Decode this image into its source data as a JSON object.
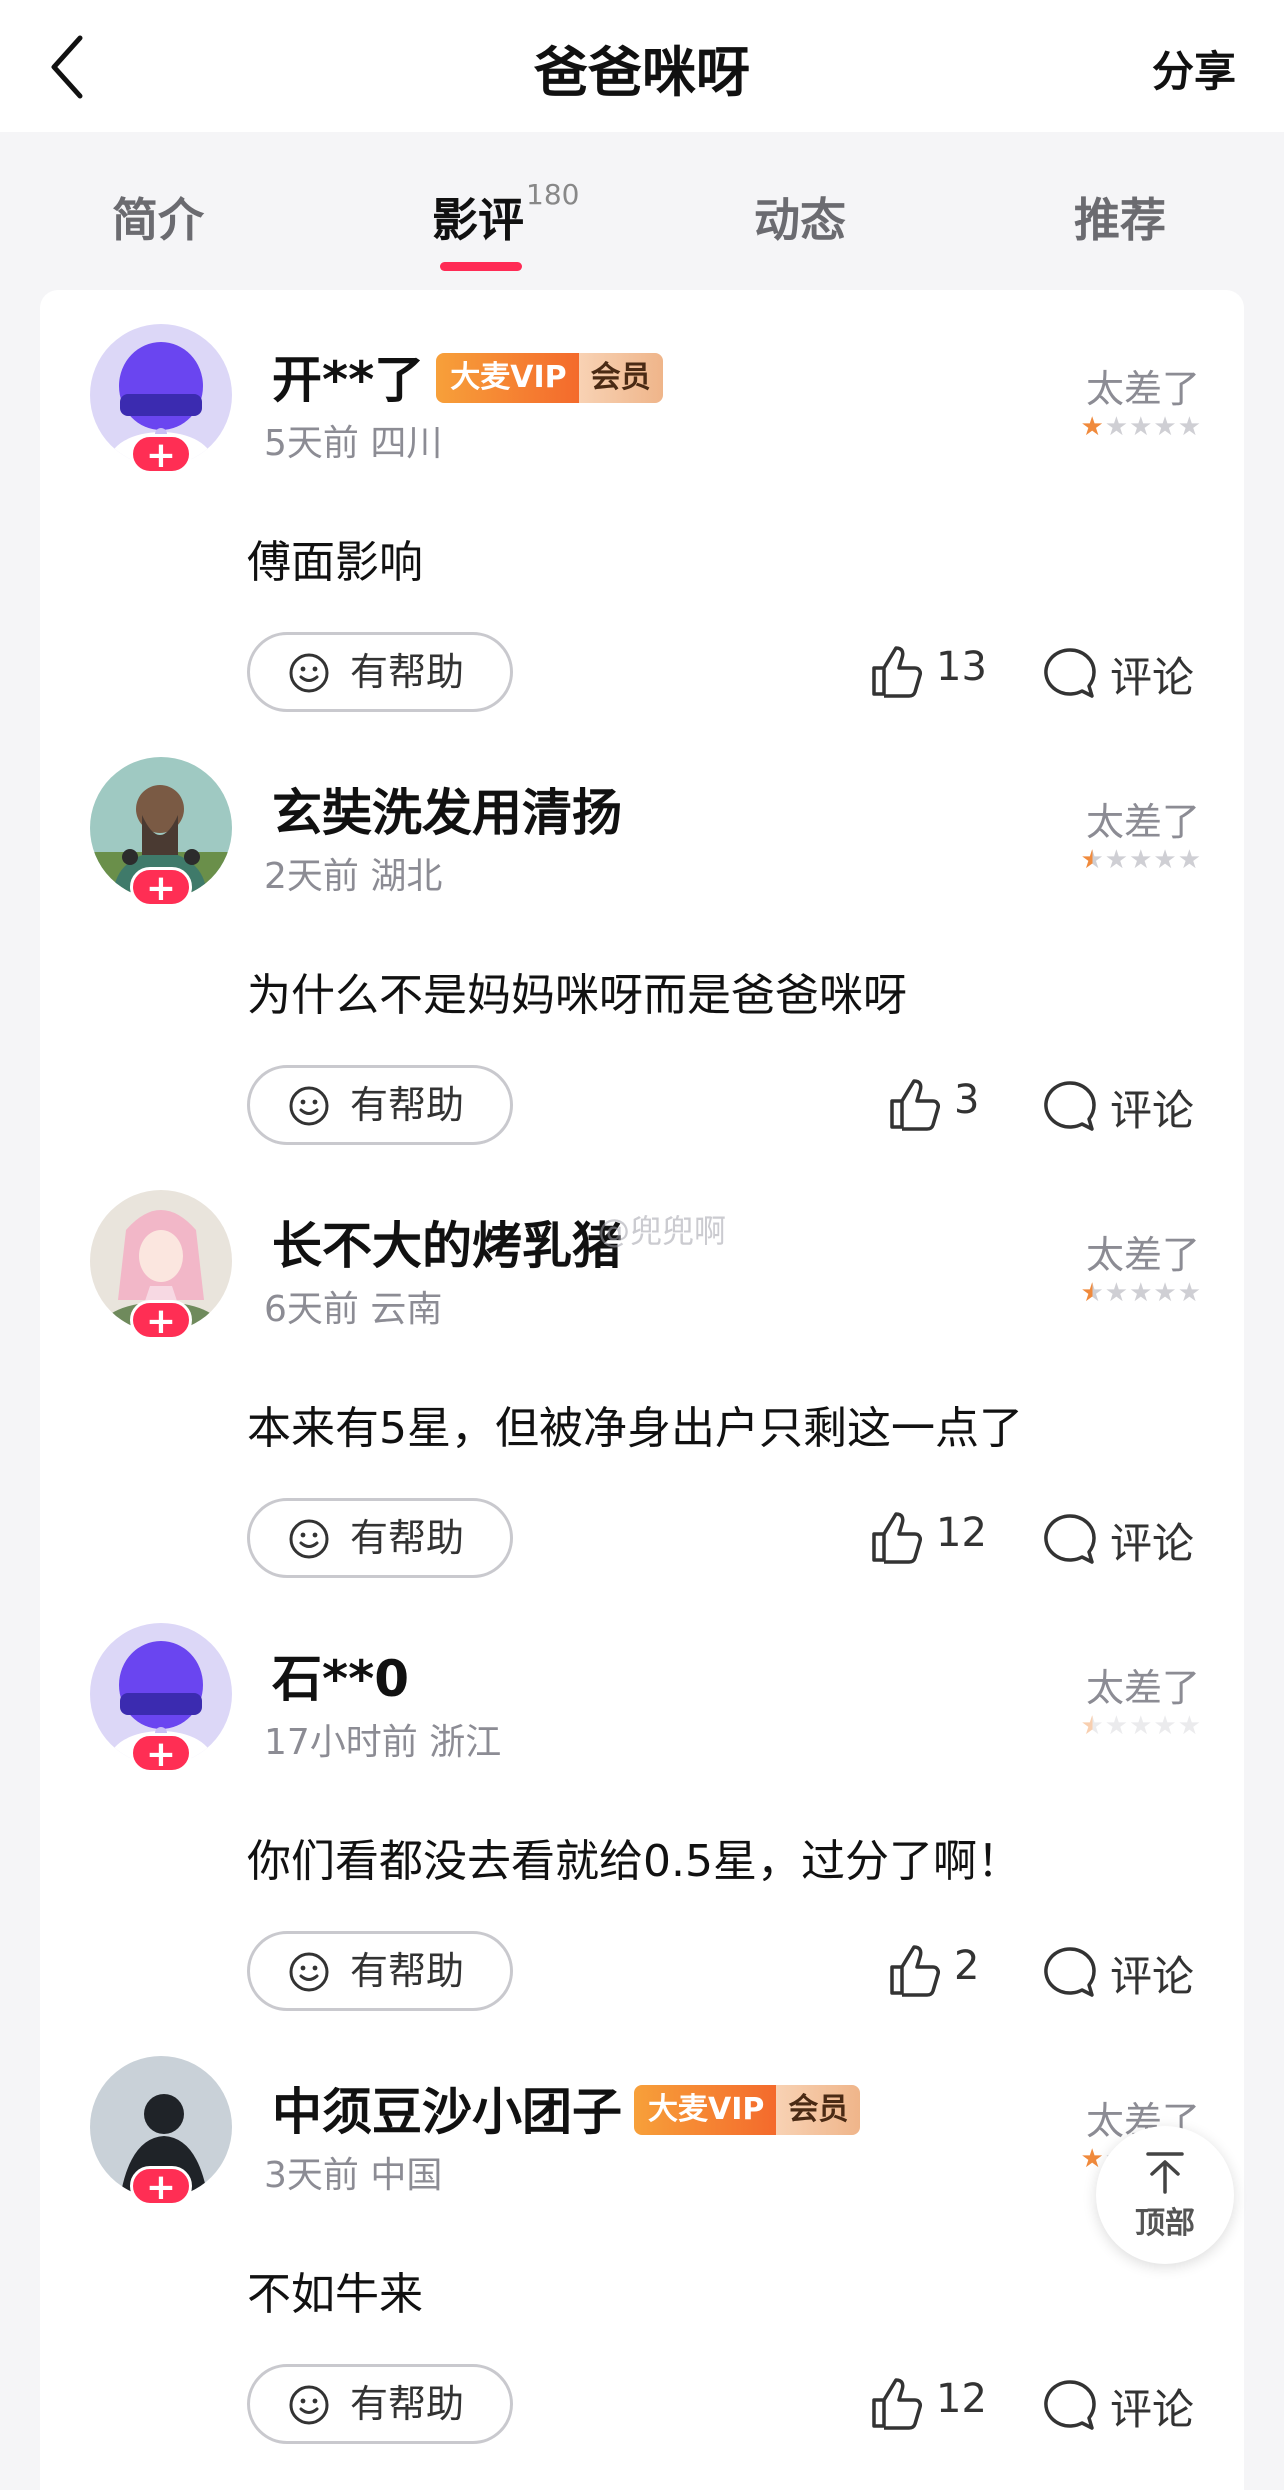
{
  "header": {
    "title": "爸爸咪呀",
    "share_label": "分享"
  },
  "tabs": [
    {
      "label": "简介"
    },
    {
      "label": "影评",
      "count": "180",
      "active": true
    },
    {
      "label": "动态"
    },
    {
      "label": "推荐"
    }
  ],
  "vip": {
    "a": "大麦VIP",
    "b": "会员"
  },
  "watermark": "@兜兜啊",
  "back_to_top": "顶部",
  "reviews": [
    {
      "user": "开**了",
      "vip": true,
      "meta": "5天前 四川",
      "rating_label": "太差了",
      "rating": 1,
      "content": "傅面影响",
      "helpful": "有帮助",
      "likes": "13",
      "comment": "评论",
      "avatar": "vr-icon"
    },
    {
      "user": "玄奘洗发用清扬",
      "vip": false,
      "meta": "2天前 湖北",
      "rating_label": "太差了",
      "rating": 0.5,
      "content": "为什么不是妈妈咪呀而是爸爸咪呀",
      "helpful": "有帮助",
      "likes": "3",
      "comment": "评论",
      "avatar": "monk-icon"
    },
    {
      "user": "长不大的烤乳猪",
      "vip": false,
      "meta": "6天前 云南",
      "rating_label": "太差了",
      "rating": 0.5,
      "content": "本来有5星，但被净身出户只剩这一点了",
      "helpful": "有帮助",
      "likes": "12",
      "comment": "评论",
      "avatar": "anime-girl-icon"
    },
    {
      "user": "石**0",
      "vip": false,
      "meta": "17小时前 浙江",
      "rating_label": "太差了",
      "rating": 0.5,
      "content": "你们看都没去看就给0.5星，过分了啊！",
      "helpful": "有帮助",
      "likes": "2",
      "comment": "评论",
      "avatar": "vr-icon"
    },
    {
      "user": "中须豆沙小团子",
      "vip": true,
      "meta": "3天前 中国",
      "rating_label": "太差了",
      "rating": 1,
      "content": "不如牛来",
      "helpful": "有帮助",
      "likes": "12",
      "comment": "评论",
      "avatar": "man-silhouette-icon"
    }
  ]
}
